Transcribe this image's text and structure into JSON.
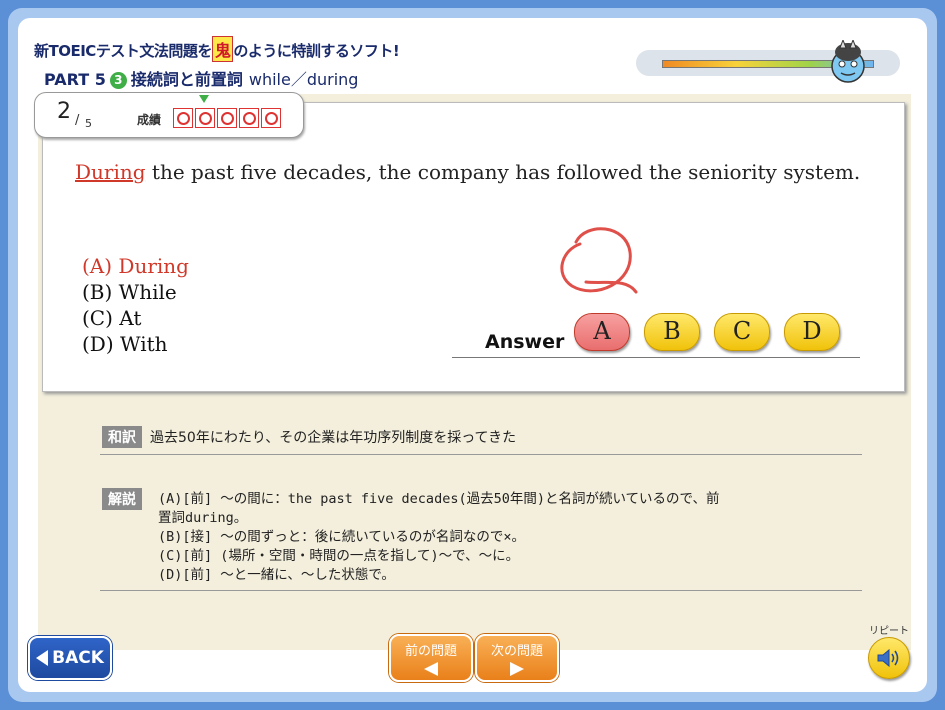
{
  "app": {
    "title_before": "新TOEICテスト文法問題を",
    "title_oni": "鬼",
    "title_after": "のように特訓するソフト!",
    "part": "PART 5",
    "section_num": "3",
    "section_name": "接続詞と前置詞",
    "topic": "while／during"
  },
  "progress": {
    "value": 1.0,
    "colors": [
      "#f08a24",
      "#f7d23a",
      "#9fd34a",
      "#6fb6f2"
    ]
  },
  "counter": {
    "current": "2",
    "slash": "/",
    "total": "5",
    "score_label": "成績",
    "scores": [
      "correct",
      "correct",
      "correct",
      "correct",
      "correct"
    ]
  },
  "question": {
    "blank_word": "During",
    "rest": " the past five decades, the company has followed the seniority system.",
    "choices": [
      {
        "label": "(A) During",
        "correct": true
      },
      {
        "label": "(B) While",
        "correct": false
      },
      {
        "label": "(C) At",
        "correct": false
      },
      {
        "label": "(D) With",
        "correct": false
      }
    ]
  },
  "answer": {
    "label": "Answer",
    "buttons": [
      "A",
      "B",
      "C",
      "D"
    ],
    "selected": "A",
    "result_icon": "correct-circle-icon"
  },
  "translation": {
    "tag": "和訳",
    "text": "過去50年にわたり、その企業は年功序列制度を採ってきた"
  },
  "explanation": {
    "tag": "解説",
    "lines": [
      "(A)[前] ～の間に：the past five decades(過去50年間)と名詞が続いているので、前",
      "置詞during。",
      "(B)[接] ～の間ずっと：後に続いているのが名詞なので×。",
      "(C)[前] (場所・空間・時間の一点を指して)～で、～に。",
      "(D)[前] ～と一緒に、～した状態で。"
    ]
  },
  "nav": {
    "back": "BACK",
    "prev": "前の問題",
    "next": "次の問題",
    "repeat": "リピート"
  }
}
